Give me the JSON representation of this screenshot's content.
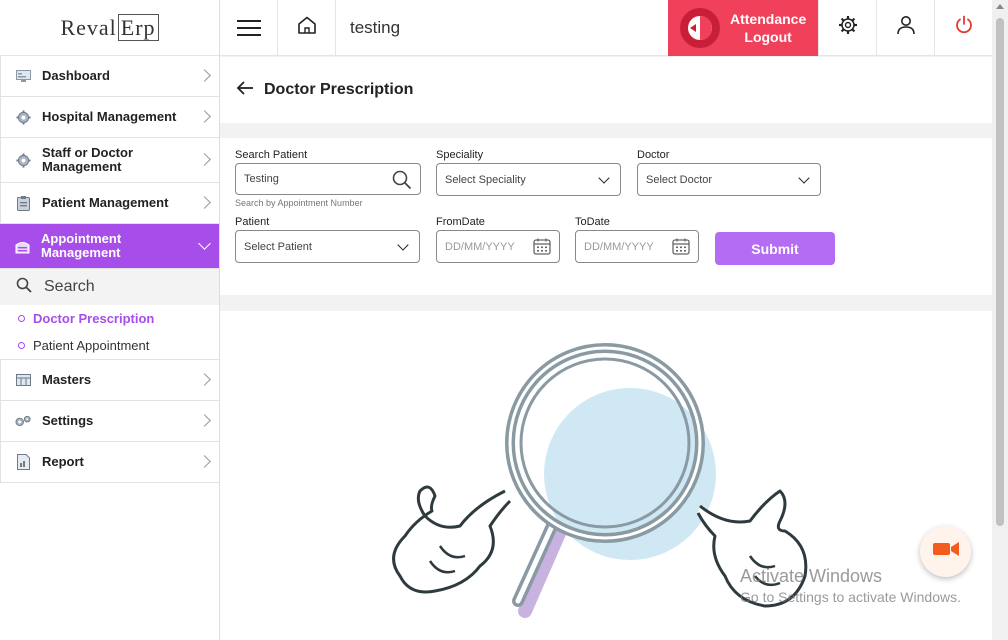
{
  "app": {
    "logo_part1": "Reval",
    "logo_part2": "Erp"
  },
  "topbar": {
    "title": "testing",
    "attendance_label_line1": "Attendance",
    "attendance_label_line2": "Logout",
    "attendance_color": "#f0405a"
  },
  "sidebar": {
    "items": [
      {
        "label": "Dashboard",
        "icon": "dashboard-icon"
      },
      {
        "label": "Hospital Management",
        "icon": "gear-icon"
      },
      {
        "label": "Staff or Doctor Management",
        "icon": "gear-icon"
      },
      {
        "label": "Patient Management",
        "icon": "clipboard-icon"
      },
      {
        "label": "Appointment Management",
        "icon": "calendar-icon"
      },
      {
        "label": "Masters",
        "icon": "grid-icon"
      },
      {
        "label": "Settings",
        "icon": "gears-icon"
      },
      {
        "label": "Report",
        "icon": "report-icon"
      }
    ],
    "submenu": {
      "search_label": "Search",
      "items": [
        "Doctor Prescription",
        "Patient Appointment"
      ]
    },
    "accent_color": "#a64dea"
  },
  "page": {
    "title": "Doctor Prescription"
  },
  "form": {
    "search_patient": {
      "label": "Search Patient",
      "value": "Testing",
      "hint": "Search by Appointment Number"
    },
    "speciality": {
      "label": "Speciality",
      "value": "Select Speciality"
    },
    "doctor": {
      "label": "Doctor",
      "value": "Select Doctor"
    },
    "patient": {
      "label": "Patient",
      "value": "Select Patient"
    },
    "from_date": {
      "label": "FromDate",
      "placeholder": "DD/MM/YYYY"
    },
    "to_date": {
      "label": "ToDate",
      "placeholder": "DD/MM/YYYY"
    },
    "submit_label": "Submit",
    "submit_color": "#b56cf5"
  },
  "watermark": {
    "line1": "Activate Windows",
    "line2": "Go to Settings to activate Windows."
  }
}
